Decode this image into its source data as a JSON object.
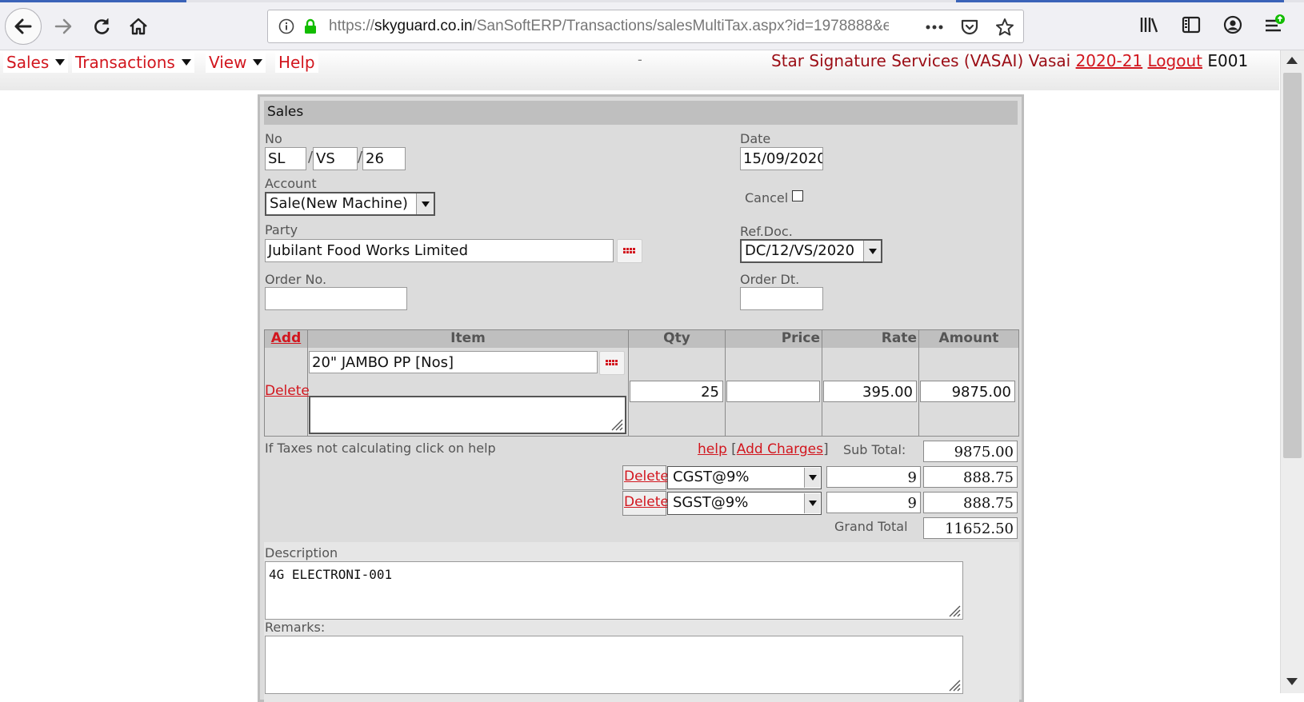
{
  "browser": {
    "url_proto": "https://",
    "url_host": "skyguard.co.in",
    "url_path": "/SanSoftERP/Transactions/salesMultiTax.aspx?id=1978888&e"
  },
  "menu": {
    "items": [
      {
        "label": "Sales",
        "has_caret": true
      },
      {
        "label": "Transactions",
        "has_caret": true
      },
      {
        "label": "View",
        "has_caret": true
      },
      {
        "label": "Help",
        "has_caret": false
      }
    ],
    "center_dash": "-",
    "company": "Star Signature Services (VASAI) Vasai ",
    "year": "2020-21",
    "logout": "Logout",
    "user_id": " E001"
  },
  "form": {
    "title": "Sales",
    "no_label": "No",
    "no_prefix": "SL",
    "no_branch": "VS",
    "no_number": "26",
    "date_label": "Date",
    "date_value": "15/09/2020",
    "account_label": "Account",
    "account_value": "Sale(New Machine)",
    "cancel_label": "Cancel",
    "party_label": "Party",
    "party_value": "Jubilant Food Works Limited",
    "refdoc_label": "Ref.Doc.",
    "refdoc_value": "DC/12/VS/2020",
    "order_no_label": "Order No.",
    "order_no_value": "",
    "order_dt_label": "Order Dt.",
    "order_dt_value": ""
  },
  "grid": {
    "headers": {
      "add": "Add",
      "item": "Item",
      "qty": "Qty",
      "price": "Price",
      "rate": "Rate",
      "amount": "Amount"
    },
    "row": {
      "delete": "Delete",
      "item": "20\" JAMBO PP [Nos]",
      "qty": "25",
      "price": "",
      "rate": "395.00",
      "amount": "9875.00",
      "note": ""
    }
  },
  "totals": {
    "tax_hint": "If Taxes not calculating click on help",
    "help": "help",
    "add_charges": "Add Charges",
    "subtotal_label": "Sub Total:",
    "subtotal": "9875.00",
    "taxes": [
      {
        "delete": "Delete",
        "name": "CGST@9%",
        "rate": "9",
        "amount": "888.75"
      },
      {
        "delete": "Delete",
        "name": "SGST@9%",
        "rate": "9",
        "amount": "888.75"
      }
    ],
    "grand_total_label": "Grand Total",
    "grand_total": "11652.50"
  },
  "description": {
    "label": "Description",
    "value": "4G ELECTRONI-001"
  },
  "remarks": {
    "label": "Remarks:",
    "value": ""
  }
}
